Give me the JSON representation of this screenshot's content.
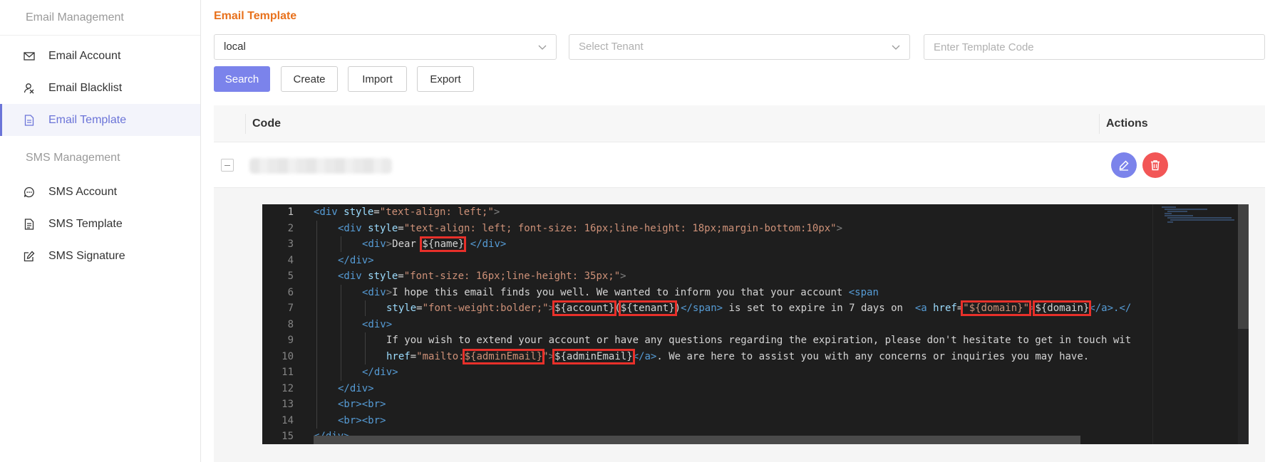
{
  "sidebar": {
    "email_section": "Email Management",
    "sms_section": "SMS Management",
    "items": [
      {
        "label": "Email Account",
        "icon": "mail-icon"
      },
      {
        "label": "Email Blacklist",
        "icon": "user-block-icon"
      },
      {
        "label": "Email Template",
        "icon": "document-icon",
        "active": true
      },
      {
        "label": "SMS Account",
        "icon": "chat-icon"
      },
      {
        "label": "SMS Template",
        "icon": "document-lines-icon"
      },
      {
        "label": "SMS Signature",
        "icon": "edit-square-icon"
      }
    ]
  },
  "header": {
    "title": "Email Template"
  },
  "filters": {
    "environment_value": "local",
    "tenant_placeholder": "Select Tenant",
    "code_placeholder": "Enter Template Code"
  },
  "toolbar": {
    "search_label": "Search",
    "create_label": "Create",
    "import_label": "Import",
    "export_label": "Export"
  },
  "table": {
    "columns": {
      "code": "Code",
      "actions": "Actions"
    }
  },
  "editor": {
    "line_numbers": [
      "1",
      "2",
      "3",
      "4",
      "5",
      "6",
      "7",
      "8",
      "9",
      "10",
      "11",
      "12",
      "13",
      "14",
      "15"
    ],
    "lines": {
      "l1": {
        "t1": "<div",
        "a1": " style",
        "p1": "=",
        "s1": "\"text-align: left;\"",
        "t2": ">"
      },
      "l2": {
        "t1": "<div",
        "a1": " style",
        "p1": "=",
        "s1": "\"text-align: left; font-size: 16px;line-height: 18px;margin-bottom:10px\"",
        "t2": ">"
      },
      "l3": {
        "t1": "<div",
        "t2": ">",
        "x1": "Dear ",
        "v1": "${name}",
        "x2": " ",
        "t3": "</div>"
      },
      "l4": {
        "t1": "</div>"
      },
      "l5": {
        "t1": "<div",
        "a1": " style",
        "p1": "=",
        "s1": "\"font-size: 16px;line-height: 35px;\"",
        "t2": ">"
      },
      "l6": {
        "t1": "<div",
        "t2": ">",
        "x1": "I hope this email finds you well. We wanted to inform you that your account ",
        "t3": "<span"
      },
      "l7": {
        "a1": "style",
        "p1": "=",
        "s1": "\"font-weight:bolder;\"",
        "t1": ">",
        "v1": "${account}",
        "x1": "(",
        "v2": "${tenant}",
        "x2": ")",
        "t2": "</span>",
        "x3": " is set to expire in 7 days on  ",
        "t3": "<a",
        "a2": " href",
        "p2": "=",
        "s2": "\"",
        "v3": "${domain}",
        "s3": "\"",
        "t4": ">",
        "v4": "${domain}",
        "t5": "</a>",
        "x4": ".</"
      },
      "l8": {
        "t1": "<div>"
      },
      "l9": {
        "x1": "If you wish to extend your account or have any questions regarding the expiration, please don't hesitate to get in touch wit"
      },
      "l10": {
        "a1": "href",
        "p1": "=",
        "s1": "\"mailto:",
        "v1": "${adminEmail}",
        "s2": "\"",
        "t1": ">",
        "v2": "${adminEmail}",
        "t2": "</a>",
        "x1": ". We are here to assist you with any concerns or inquiries you may have."
      },
      "l11": {
        "t1": "</div>"
      },
      "l12": {
        "t1": "</div>"
      },
      "l13": {
        "t1": "<br><br>"
      },
      "l14": {
        "t1": "<br><br>"
      },
      "l15": {
        "t1": "</div>"
      }
    }
  },
  "colors": {
    "accent": "#7b83eb",
    "title": "#e8711c",
    "danger": "#f25656",
    "highlight": "#e8302a"
  }
}
